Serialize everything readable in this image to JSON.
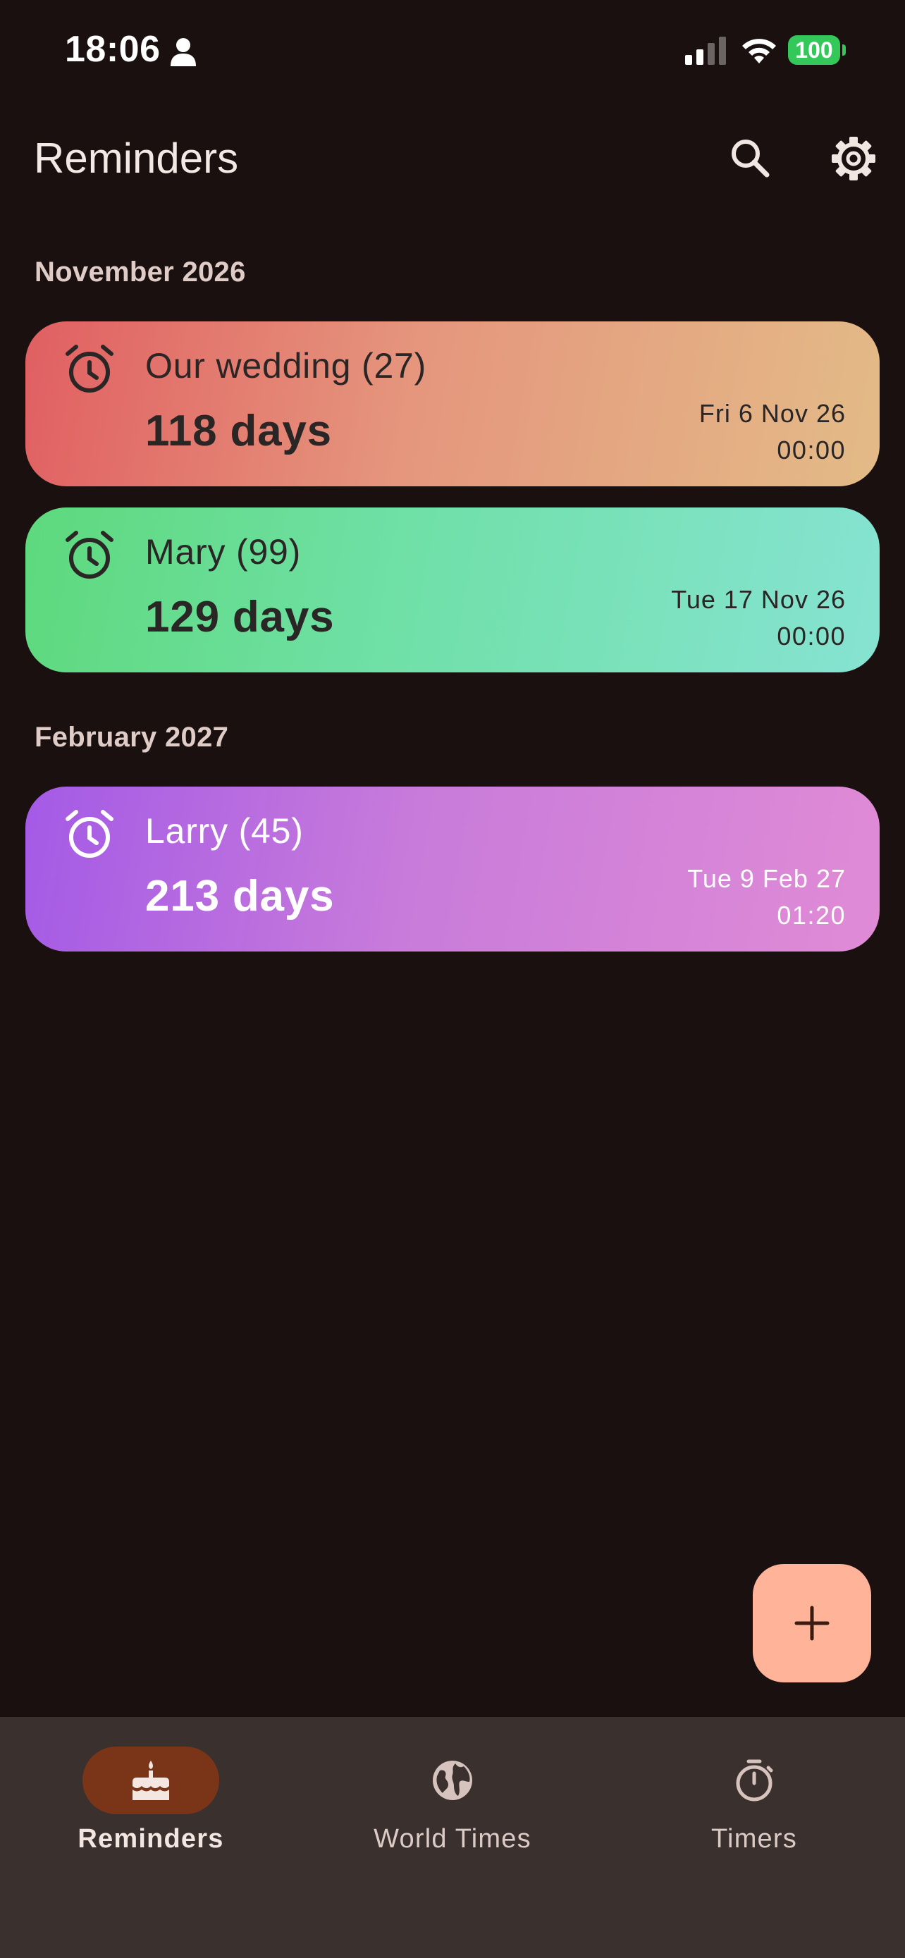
{
  "status_bar": {
    "time": "18:06",
    "battery": "100"
  },
  "app_bar": {
    "title": "Reminders",
    "search_icon": "search-icon",
    "settings_icon": "gear-icon"
  },
  "sections": [
    {
      "header": "November 2026",
      "reminders": [
        {
          "title": "Our wedding (27)",
          "days": "118 days",
          "date": "Fri 6 Nov 26",
          "time": "00:00"
        },
        {
          "title": "Mary (99)",
          "days": "129 days",
          "date": "Tue 17 Nov 26",
          "time": "00:00"
        }
      ]
    },
    {
      "header": "February 2027",
      "reminders": [
        {
          "title": "Larry (45)",
          "days": "213 days",
          "date": "Tue 9 Feb 27",
          "time": "01:20"
        }
      ]
    }
  ],
  "fab": {
    "icon": "plus-icon"
  },
  "bottom_nav": {
    "items": [
      {
        "label": "Reminders",
        "icon": "cake-icon",
        "active": true
      },
      {
        "label": "World Times",
        "icon": "globe-icon",
        "active": false
      },
      {
        "label": "Timers",
        "icon": "stopwatch-icon",
        "active": false
      }
    ]
  },
  "colors": {
    "background": "#1a1010",
    "nav_background": "#3a302e",
    "active_pill": "#7a3519",
    "fab": "#ffb49a",
    "card_1_gradient": [
      "#e15f62",
      "#e3bb87"
    ],
    "card_2_gradient": [
      "#5ed97d",
      "#86e3d2"
    ],
    "card_3_gradient": [
      "#a45ae6",
      "#e08bd6"
    ]
  }
}
